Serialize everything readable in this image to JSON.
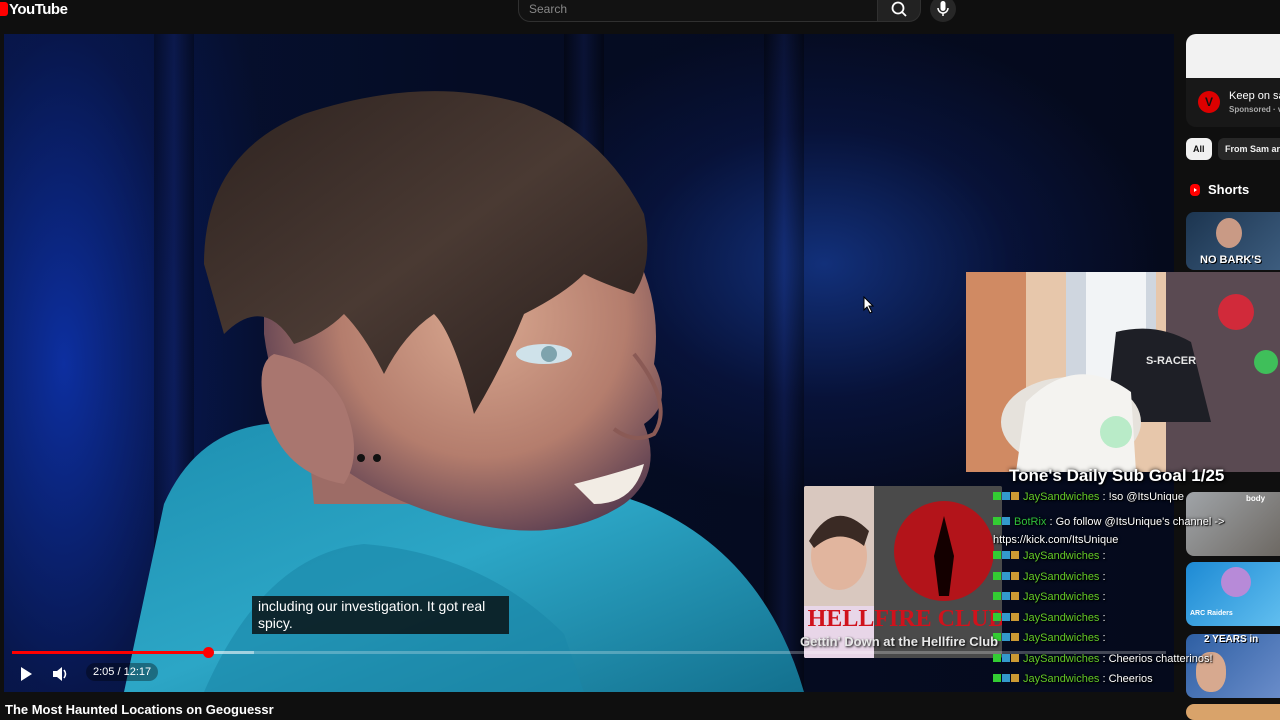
{
  "header": {
    "logo_text": "YouTube",
    "search_placeholder": "Search",
    "search_icon": "search-icon",
    "mic_icon": "mic-icon"
  },
  "player": {
    "caption": "including our investigation. It got real spicy.",
    "time_display": "2:05 / 12:17",
    "progress_fraction": 0.17,
    "buffered_fraction": 0.21,
    "play_icon": "play-icon",
    "volume_icon": "volume-icon",
    "accent_color": "#ff0000"
  },
  "video": {
    "title": "The Most Haunted Locations on Geoguessr"
  },
  "sidebar": {
    "ad": {
      "title": "Keep on sa",
      "sponsored_label": "Sponsored",
      "sponsored_suffix": " · v",
      "logo_letter": "V"
    },
    "chips": [
      "All",
      "From Sam ar"
    ],
    "shorts_label": "Shorts",
    "short_thumbs": [
      {
        "caption": "NO BARK'S"
      },
      {
        "caption": "body"
      },
      {
        "caption": "ARC Raiders"
      },
      {
        "caption": "2 YEARS in"
      }
    ]
  },
  "stream_overlay": {
    "title": "Tone's Daily Sub Goal 1/25",
    "webcam_chair_text": "S-RACER",
    "chat": [
      {
        "user": "JaySandwiches",
        "user_color": "#63c928",
        "message": " : !so @ItsUnique"
      },
      {
        "user": "BotRix",
        "user_color": "#2fbf3b",
        "message": " : Go follow @ItsUnique's channel -> https://kick.com/ItsUnique"
      },
      {
        "user": "JaySandwiches",
        "user_color": "#63c928",
        "message": " :"
      },
      {
        "user": "JaySandwiches",
        "user_color": "#63c928",
        "message": " :"
      },
      {
        "user": "JaySandwiches",
        "user_color": "#63c928",
        "message": " :"
      },
      {
        "user": "JaySandwiches",
        "user_color": "#63c928",
        "message": " :"
      },
      {
        "user": "JaySandwiches",
        "user_color": "#63c928",
        "message": " :"
      },
      {
        "user": "JaySandwiches",
        "user_color": "#63c928",
        "message": " : Cheerios chatterinos!"
      },
      {
        "user": "JaySandwiches",
        "user_color": "#63c928",
        "message": " : Cheerios"
      }
    ]
  },
  "endcard": {
    "title": "Gettin' Down at the Hellfire Club",
    "logo_text": "HELLFIRE CLUB"
  }
}
